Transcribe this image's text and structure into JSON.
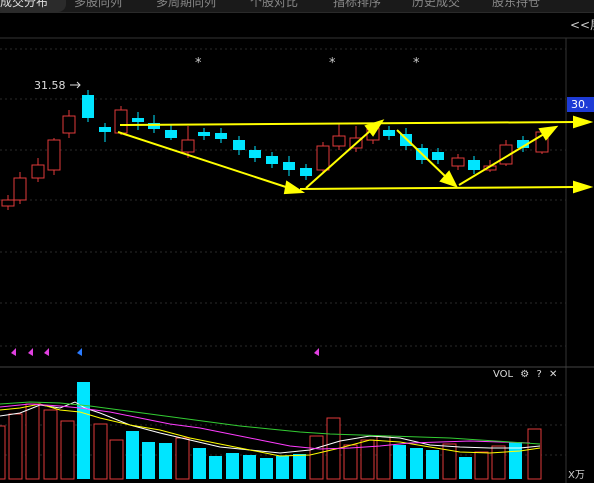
{
  "tabs": [
    {
      "label": "成交分布",
      "active": true
    },
    {
      "label": "多股同列",
      "active": false
    },
    {
      "label": "多周期同列",
      "active": false
    },
    {
      "label": "个股对比",
      "active": false
    },
    {
      "label": "指标排序",
      "active": false
    },
    {
      "label": "历史成交",
      "active": false
    },
    {
      "label": "股东持仓",
      "active": false
    }
  ],
  "expand_button": "<<展",
  "price_high_label": "31.58",
  "current_price_badge": "30.",
  "volume_panel": {
    "title": "VOL",
    "gear_icon": "gear-icon",
    "help_label": "?",
    "close_label": "✕",
    "unit_label": "X万"
  },
  "marker_symbol": "*",
  "colors": {
    "background": "#000000",
    "up_candle": "#e03a3a",
    "down_candle": "#00e5ff",
    "trendline": "#ffff00",
    "grid": "#2a2a2a",
    "ma_white": "#ffffff",
    "ma_yellow": "#ffff00",
    "ma_magenta": "#ff3cff",
    "ma_green": "#33cc33",
    "badge": "#1d3bd6"
  }
}
